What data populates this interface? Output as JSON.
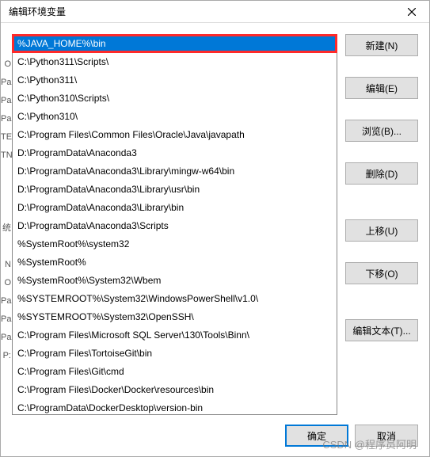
{
  "titlebar": {
    "title": "编辑环境变量"
  },
  "paths": [
    "%JAVA_HOME%\\bin",
    "C:\\Python311\\Scripts\\",
    "C:\\Python311\\",
    "C:\\Python310\\Scripts\\",
    "C:\\Python310\\",
    "C:\\Program Files\\Common Files\\Oracle\\Java\\javapath",
    "D:\\ProgramData\\Anaconda3",
    "D:\\ProgramData\\Anaconda3\\Library\\mingw-w64\\bin",
    "D:\\ProgramData\\Anaconda3\\Library\\usr\\bin",
    "D:\\ProgramData\\Anaconda3\\Library\\bin",
    "D:\\ProgramData\\Anaconda3\\Scripts",
    "%SystemRoot%\\system32",
    "%SystemRoot%",
    "%SystemRoot%\\System32\\Wbem",
    "%SYSTEMROOT%\\System32\\WindowsPowerShell\\v1.0\\",
    "%SYSTEMROOT%\\System32\\OpenSSH\\",
    "C:\\Program Files\\Microsoft SQL Server\\130\\Tools\\Binn\\",
    "C:\\Program Files\\TortoiseGit\\bin",
    "C:\\Program Files\\Git\\cmd",
    "C:\\Program Files\\Docker\\Docker\\resources\\bin",
    "C:\\ProgramData\\DockerDesktop\\version-bin"
  ],
  "selected_index": 0,
  "buttons": {
    "new": "新建(N)",
    "edit": "编辑(E)",
    "browse": "浏览(B)...",
    "delete": "删除(D)",
    "moveup": "上移(U)",
    "movedown": "下移(O)",
    "edittext": "编辑文本(T)...",
    "ok": "确定",
    "cancel": "取消"
  },
  "watermark": "CSDN @程序员阿明",
  "left_fragments": [
    "",
    "",
    "",
    "O",
    "Pa",
    "Pa",
    "Pa",
    "TE",
    "TN",
    "",
    "",
    "",
    "统",
    "",
    "N",
    "O",
    "Pa",
    "Pa",
    "Pa",
    "P:",
    ""
  ]
}
